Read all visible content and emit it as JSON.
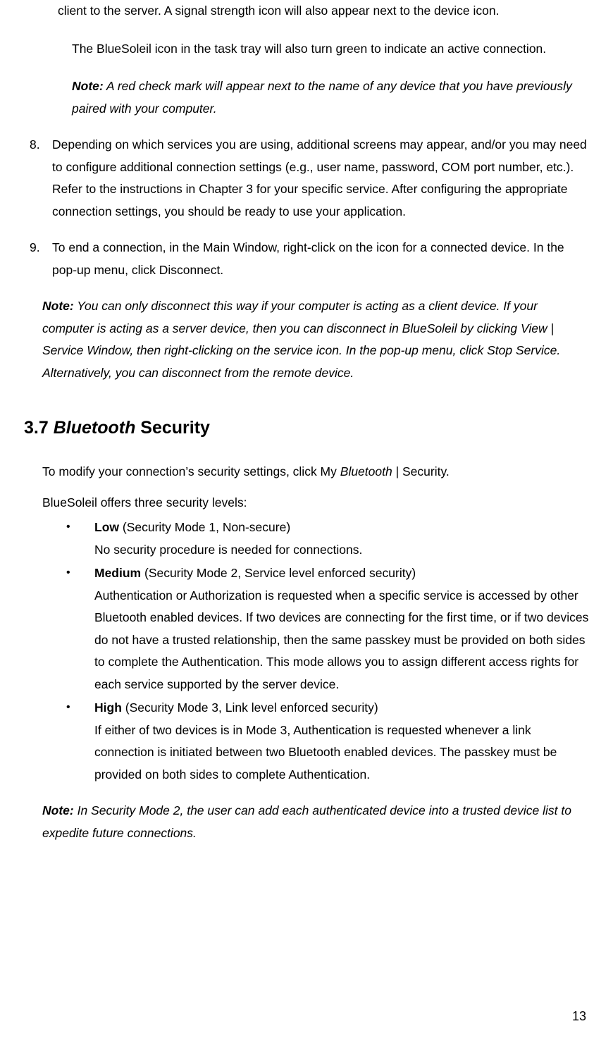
{
  "topFragment": "client to the server. A signal strength icon will also appear next to the device icon.",
  "taskTrayPara": "The BlueSoleil icon in the task tray will also turn green to indicate an active connection.",
  "topNote": {
    "label": "Note:",
    "text": " A red check mark will appear next to the name of any device that you have previously paired with your computer."
  },
  "steps": [
    {
      "num": "8.",
      "text": "Depending on which services you are using, additional screens may appear, and/or you may need to configure additional connection settings (e.g., user name, password, COM port number, etc.). Refer to the instructions in Chapter 3 for your specific service. After configuring the appropriate connection settings, you should be ready to use your application."
    },
    {
      "num": "9.",
      "text": "To end a connection, in the Main Window, right-click on the icon for a connected device. In the pop-up menu, click Disconnect."
    }
  ],
  "midNote": {
    "label": "Note:",
    "text": " You can only disconnect this way if your computer is acting as a client device. If your computer is acting as a server device, then you can disconnect in BlueSoleil by clicking View | Service Window, then right-clicking on the service icon. In the pop-up menu, click Stop Service. Alternatively, you can disconnect from the remote device."
  },
  "heading": {
    "num": "3.7 ",
    "italic": "Bluetooth",
    "rest": " Security"
  },
  "securityIntro": {
    "pre": "To modify your connection’s security settings, click My ",
    "italic": "Bluetooth",
    "post": " | Security."
  },
  "securityLevelsLabel": "BlueSoleil offers three security levels:",
  "bullets": [
    {
      "title": "Low",
      "paren": " (Security Mode 1, Non-secure)",
      "desc": "No security procedure is needed for connections."
    },
    {
      "title": "Medium",
      "paren": " (Security Mode 2, Service level enforced security)",
      "desc": "Authentication or Authorization is requested when a specific service is accessed by other Bluetooth enabled devices. If two devices are connecting for the first time, or if two devices do not have a trusted relationship, then the same passkey must be provided on both sides to complete the Authentication. This mode allows you to assign different access rights for each service supported by the server device."
    },
    {
      "title": "High",
      "paren": " (Security Mode 3, Link level enforced security)",
      "desc": "If either of two devices is in Mode 3, Authentication is requested whenever a link connection is initiated between two Bluetooth enabled devices. The passkey must be provided on both sides to complete Authentication."
    }
  ],
  "bottomNote": {
    "label": "Note:",
    "text": " In Security Mode 2, the user can add each authenticated device into a trusted device list to expedite future connections."
  },
  "pageNumber": "13"
}
